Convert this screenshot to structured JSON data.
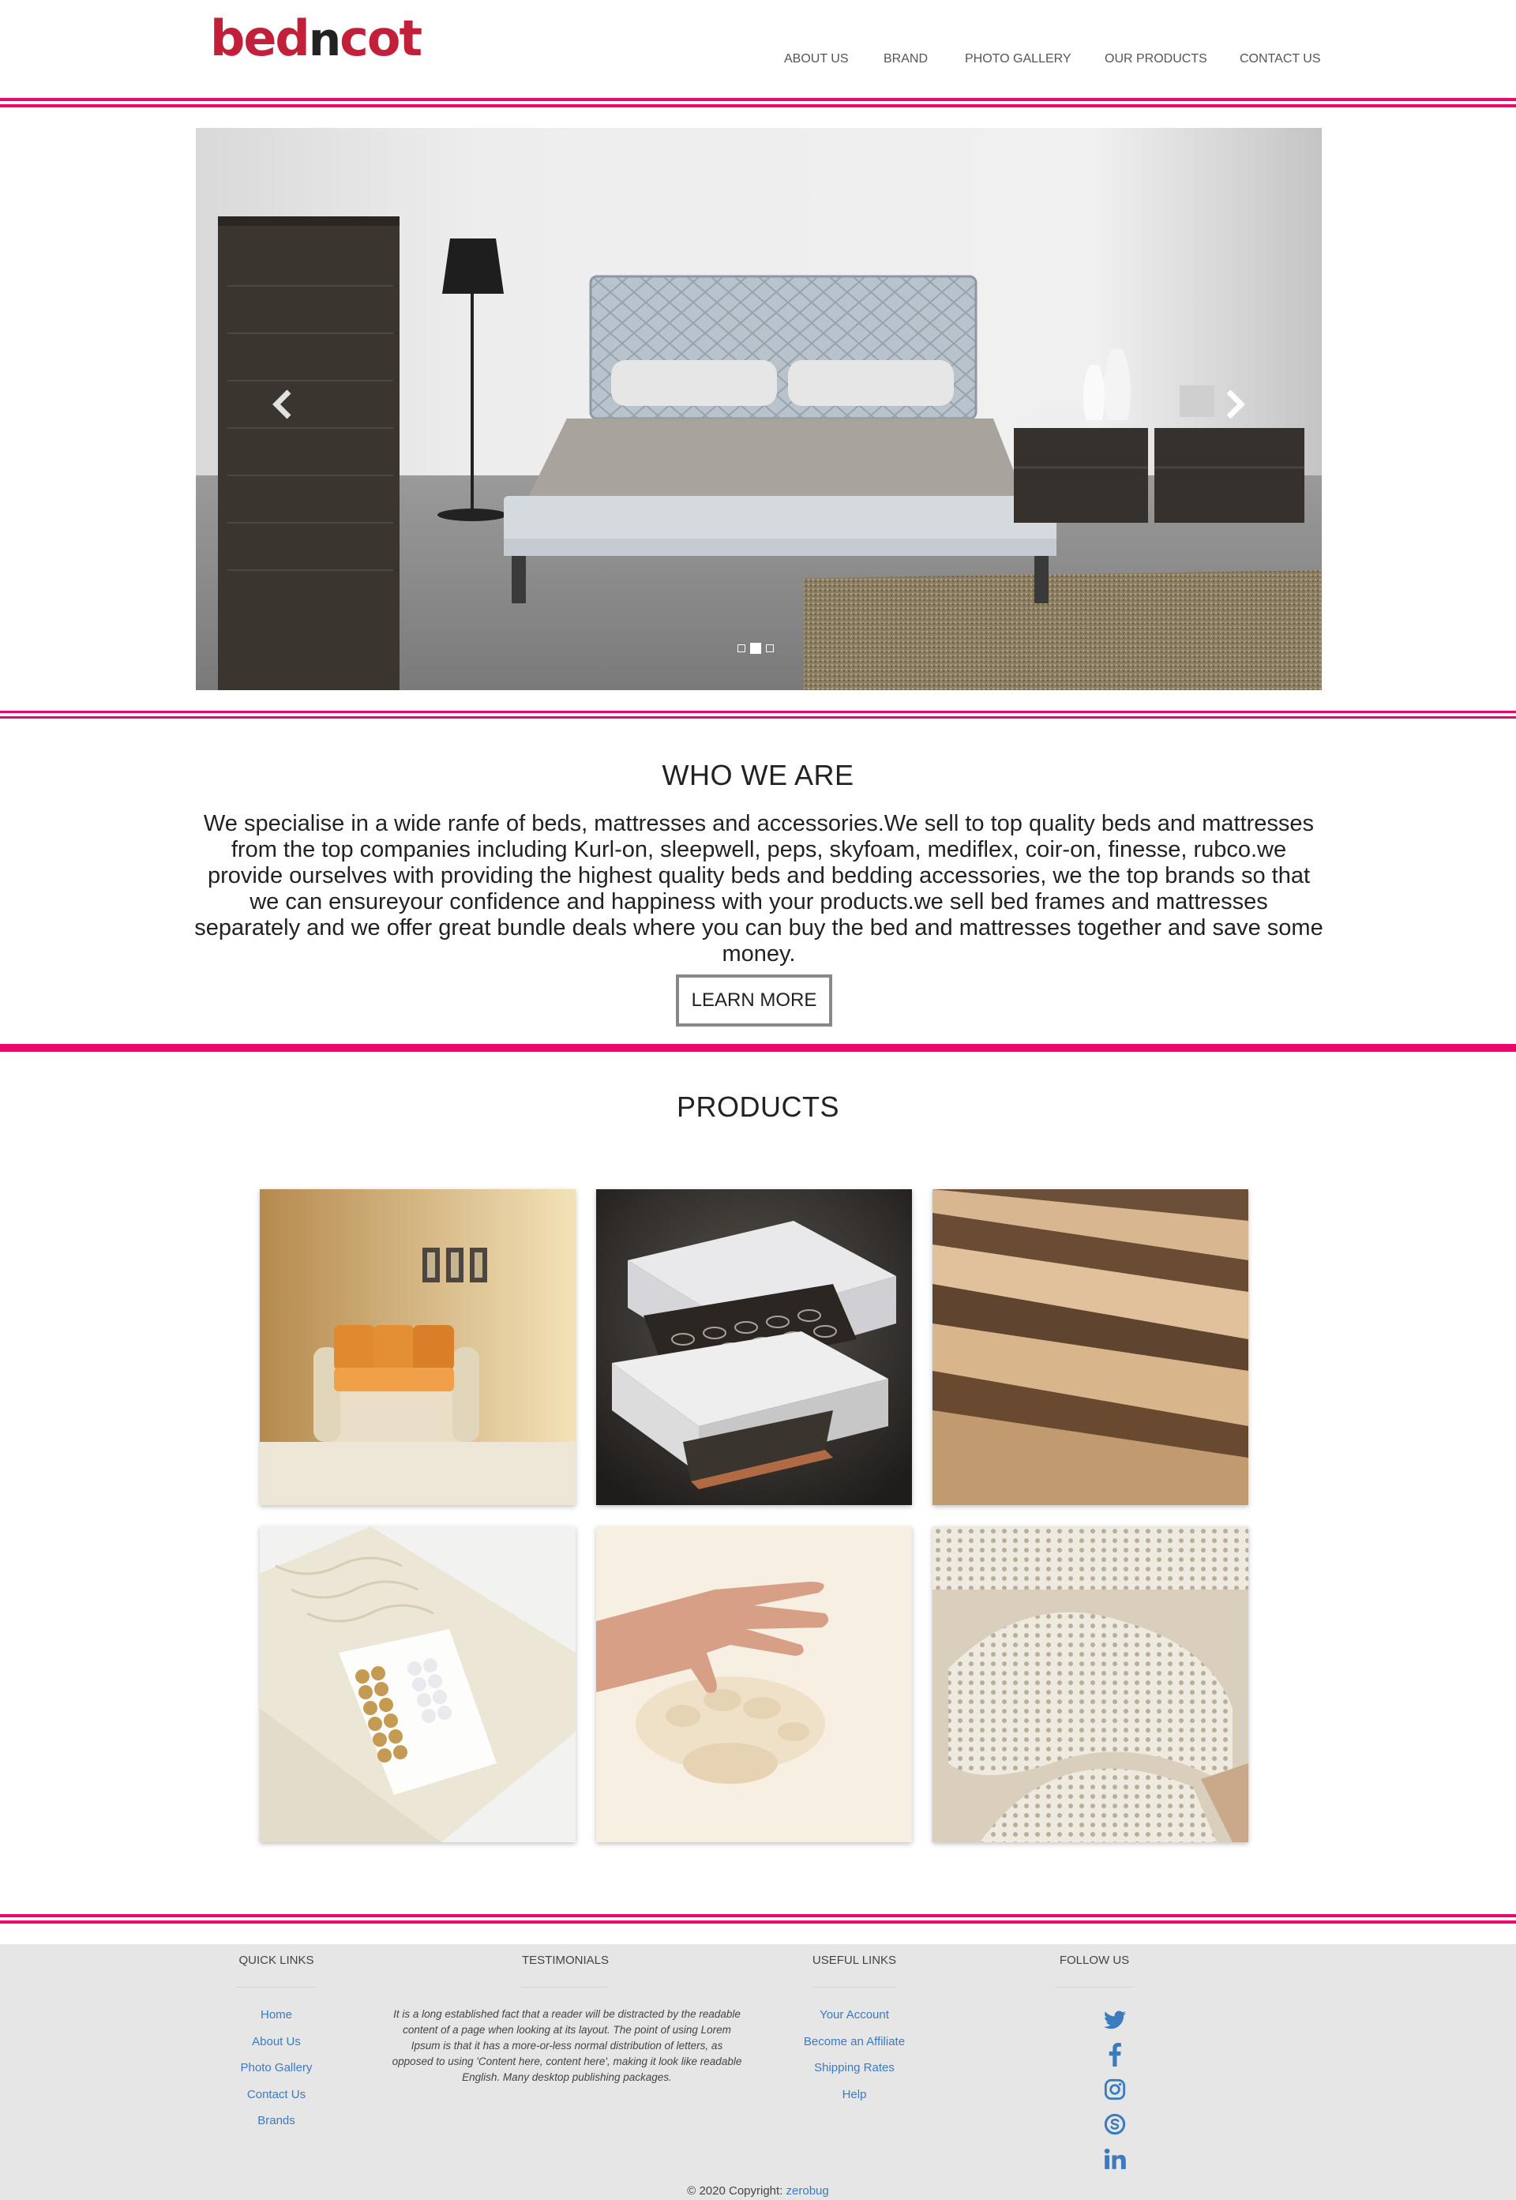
{
  "brand": {
    "logo_part1": "bed",
    "logo_part2": "n",
    "logo_part3": "cot",
    "accent": "#f0056f",
    "logo_red": "#c2203a"
  },
  "nav": {
    "items": [
      {
        "label": "ABOUT US"
      },
      {
        "label": "BRAND"
      },
      {
        "label": "PHOTO GALLERY"
      },
      {
        "label": "OUR PRODUCTS"
      },
      {
        "label": "CONTACT US"
      }
    ]
  },
  "slider": {
    "prev_icon": "chevron-left-icon",
    "next_icon": "chevron-right-icon",
    "slide_count": 3,
    "active_slide": 2
  },
  "about": {
    "title": "WHO WE ARE",
    "text": "We specialise in a wide ranfe of beds, mattresses and accessories.We sell to top quality beds and mattresses from the top companies including Kurl-on, sleepwell, peps, skyfoam, mediflex, coir-on, finesse, rubco.we provide ourselves with providing the highest quality beds and bedding accessories, we the top brands so that we can ensureyour confidence and happiness with your products.we sell bed frames and mattresses separately and we offer great bundle deals where you can buy the bed and mattresses together and save some money.",
    "button": "LEARN MORE"
  },
  "products": {
    "title": "PRODUCTS"
  },
  "footer": {
    "quick_links": {
      "title": "QUICK LINKS",
      "items": [
        "Home",
        "About Us",
        "Photo Gallery",
        "Contact Us",
        "Brands"
      ]
    },
    "testimonials": {
      "title": "TESTIMONIALS",
      "text": "It is a long established fact that a reader will be distracted by the readable content of a page when looking at its layout. The point of using Lorem Ipsum is that it has a more-or-less normal distribution of letters, as opposed to using 'Content here, content here', making it look like readable English. Many desktop publishing packages."
    },
    "useful_links": {
      "title": "USEFUL LINKS",
      "items": [
        "Your Account",
        "Become an Affiliate",
        "Shipping Rates",
        "Help"
      ]
    },
    "follow_us": {
      "title": "FOLLOW US",
      "icons": [
        "twitter-icon",
        "facebook-icon",
        "instagram-icon",
        "skype-icon",
        "linkedin-icon"
      ]
    },
    "copyright_text": "© 2020 Copyright:",
    "copyright_link": "zerobug",
    "link_color": "#3b7bbf"
  }
}
